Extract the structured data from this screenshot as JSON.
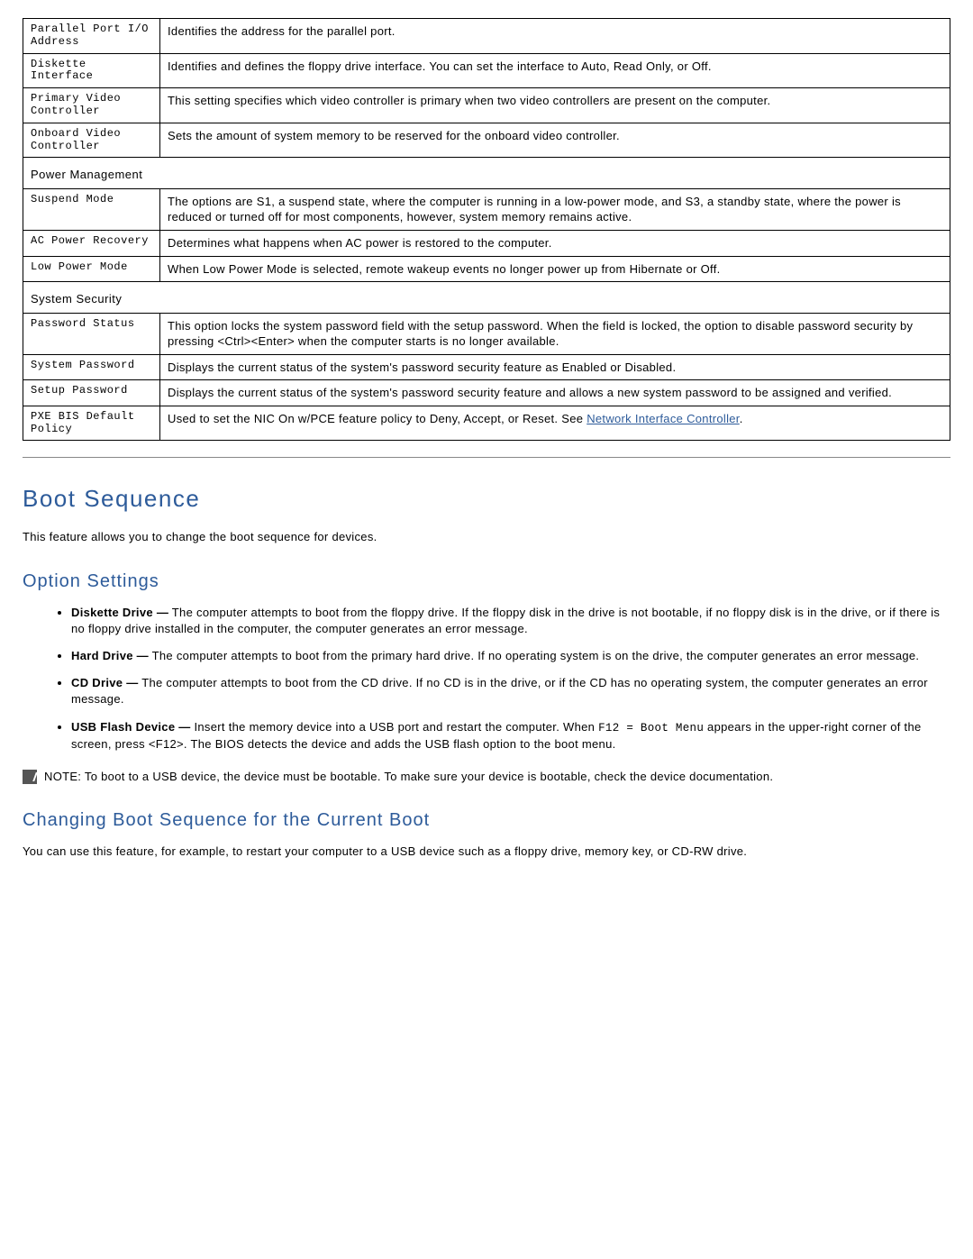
{
  "table": {
    "rows_top": [
      {
        "label": "Parallel Port I/O Address",
        "desc": "Identifies the address for the parallel port."
      },
      {
        "label": "Diskette Interface",
        "desc": "Identifies and defines the floppy drive interface. You can set the interface to Auto, Read Only, or Off."
      },
      {
        "label": "Primary Video Controller",
        "desc": "This setting specifies which video controller is primary when two video controllers are present on the computer."
      },
      {
        "label": "Onboard Video Controller",
        "desc": "Sets the amount of system memory to be reserved for the onboard video controller."
      }
    ],
    "section_pm": "Power Management",
    "rows_pm": [
      {
        "label": "Suspend Mode",
        "desc": "The options are S1, a suspend state, where the computer is running in a low-power mode, and S3, a standby state, where the power is reduced or turned off for most components, however, system memory remains active."
      },
      {
        "label": "AC Power Recovery",
        "desc": "Determines what happens when AC power is restored to the computer."
      },
      {
        "label": "Low Power Mode",
        "desc": "When Low Power Mode is selected, remote wakeup events no longer power up from Hibernate or Off."
      }
    ],
    "section_ss": "System Security",
    "rows_ss": [
      {
        "label": "Password Status",
        "desc": "This option locks the system password field with the setup password. When the field is locked, the option to disable password security by pressing <Ctrl><Enter> when the computer starts is no longer available."
      },
      {
        "label": "System Password",
        "desc": "Displays the current status of the system's password security feature as Enabled or Disabled."
      },
      {
        "label": "Setup Password",
        "desc": "Displays the current status of the system's password security feature and allows a new system password to be assigned and verified."
      }
    ],
    "pxe": {
      "label": "PXE BIS Default Policy",
      "pre": "Used to set the NIC On w/PCE feature policy to Deny, Accept, or Reset. See ",
      "link": "Network Interface Controller",
      "post": "."
    }
  },
  "headings": {
    "boot_sequence": "Boot Sequence",
    "option_settings": "Option Settings",
    "changing_boot": "Changing Boot Sequence for the Current Boot"
  },
  "paras": {
    "boot_intro": "This feature allows you to change the boot sequence for devices.",
    "changing_intro": "You can use this feature, for example, to restart your computer to a USB device such as a floppy drive, memory key, or CD-RW drive."
  },
  "options": [
    {
      "bold": "Diskette Drive —",
      "text": " The computer attempts to boot from the floppy drive. If the floppy disk in the drive is not bootable, if no floppy disk is in the drive, or if there is no floppy drive installed in the computer, the computer generates an error message."
    },
    {
      "bold": "Hard Drive —",
      "text": " The computer attempts to boot from the primary hard drive. If no operating system is on the drive, the computer generates an error message."
    },
    {
      "bold": "CD Drive —",
      "text": " The computer attempts to boot from the CD drive. If no CD is in the drive, or if the CD has no operating system, the computer generates an error message."
    }
  ],
  "usb_option": {
    "bold": "USB Flash Device —",
    "t1": " Insert the memory device into a USB port and restart the computer. When ",
    "mono": "F12 = Boot Menu",
    "t2": " appears in the upper-right corner of the screen, press <F12>. The BIOS detects the device and adds the USB flash option to the boot menu."
  },
  "note": {
    "label": "NOTE:",
    "text": " To boot to a USB device, the device must be bootable. To make sure your device is bootable, check the device documentation."
  }
}
